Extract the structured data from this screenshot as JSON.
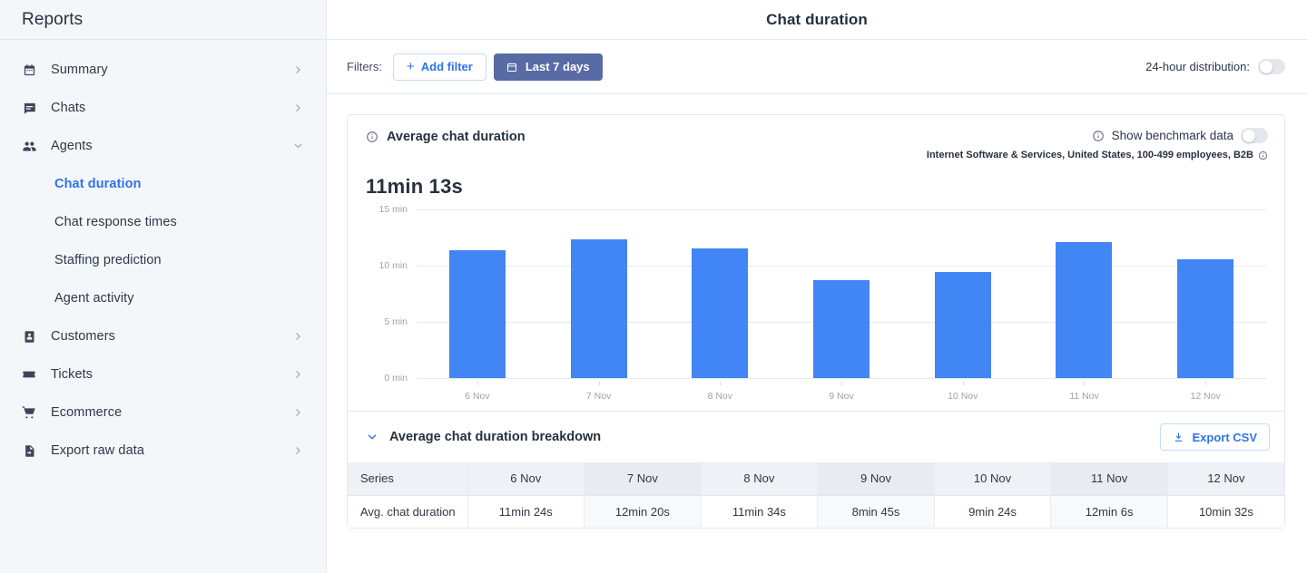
{
  "sidebar": {
    "title": "Reports",
    "items": [
      {
        "label": "Summary",
        "icon": "calendar-icon",
        "chevron": "chevron-right-icon",
        "expanded": false
      },
      {
        "label": "Chats",
        "icon": "chat-bubble-icon",
        "chevron": "chevron-right-icon",
        "expanded": false
      },
      {
        "label": "Agents",
        "icon": "people-icon",
        "chevron": "chevron-down-icon",
        "expanded": true
      },
      {
        "label": "Customers",
        "icon": "contact-card-icon",
        "chevron": "chevron-right-icon",
        "expanded": false
      },
      {
        "label": "Tickets",
        "icon": "ticket-icon",
        "chevron": "chevron-right-icon",
        "expanded": false
      },
      {
        "label": "Ecommerce",
        "icon": "shopping-cart-icon",
        "chevron": "chevron-right-icon",
        "expanded": false
      },
      {
        "label": "Export raw data",
        "icon": "file-export-icon",
        "chevron": "chevron-right-icon",
        "expanded": false
      }
    ],
    "agents_subitems": [
      {
        "label": "Chat duration",
        "active": true
      },
      {
        "label": "Chat response times",
        "active": false
      },
      {
        "label": "Staffing prediction",
        "active": false
      },
      {
        "label": "Agent activity",
        "active": false
      }
    ]
  },
  "header": {
    "page_title": "Chat duration"
  },
  "filterbar": {
    "filters_label": "Filters:",
    "add_filter_label": "Add filter",
    "add_filter_icon": "plus-icon",
    "date_range_label": "Last 7 days",
    "date_range_icon": "calendar-icon",
    "distribution_toggle_label": "24-hour distribution:",
    "distribution_toggle_state": "off"
  },
  "card": {
    "title": "Average chat duration",
    "title_icon": "info-icon",
    "benchmark_label": "Show benchmark data",
    "benchmark_icon": "info-icon",
    "benchmark_toggle_state": "off",
    "benchmark_segment": "Internet Software & Services, United States, 100-499 employees, B2B",
    "benchmark_segment_icon": "info-icon",
    "big_value": "11min 13s"
  },
  "breakdown": {
    "collapse_icon": "chevron-down-icon",
    "title": "Average chat duration breakdown",
    "export_label": "Export CSV",
    "export_icon": "download-icon",
    "columns": [
      "Series",
      "6 Nov",
      "7 Nov",
      "8 Nov",
      "9 Nov",
      "10 Nov",
      "11 Nov",
      "12 Nov"
    ],
    "rows": [
      {
        "series": "Avg. chat duration",
        "values": [
          "11min 24s",
          "12min 20s",
          "11min 34s",
          "8min 45s",
          "9min 24s",
          "12min 6s",
          "10min 32s"
        ]
      }
    ]
  },
  "chart_data": {
    "type": "bar",
    "title": "Average chat duration",
    "xlabel": "",
    "ylabel": "",
    "categories": [
      "6 Nov",
      "7 Nov",
      "8 Nov",
      "9 Nov",
      "10 Nov",
      "11 Nov",
      "12 Nov"
    ],
    "values": [
      11.4,
      12.333,
      11.567,
      8.75,
      9.4,
      12.1,
      10.533
    ],
    "value_labels": [
      "11min 24s",
      "12min 20s",
      "11min 34s",
      "8min 45s",
      "9min 24s",
      "12min 6s",
      "10min 32s"
    ],
    "series": [
      {
        "name": "Avg. chat duration",
        "values": [
          11.4,
          12.333,
          11.567,
          8.75,
          9.4,
          12.1,
          10.533
        ],
        "color": "#4285f4"
      }
    ],
    "unit": "minutes",
    "ylim": [
      0,
      15
    ],
    "yticks": [
      0,
      5,
      10,
      15
    ],
    "ytick_labels": [
      "0 min",
      "5 min",
      "10 min",
      "15 min"
    ],
    "grid": true,
    "legend": false,
    "average": "11min 13s"
  },
  "colors": {
    "bar": "#4285f4",
    "accent_link": "#2f73e8",
    "date_button": "#586ba4",
    "sidebar_bg": "#f4f7fa",
    "border": "#e3e8ee",
    "text": "#27313e"
  }
}
